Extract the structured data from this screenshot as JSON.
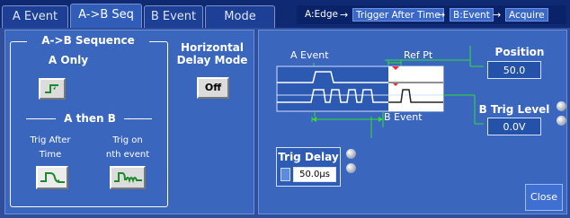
{
  "tabs": [
    {
      "label": "A Event",
      "active": false
    },
    {
      "label": "A->B Seq",
      "active": true
    },
    {
      "label": "B Event",
      "active": false
    },
    {
      "label": "Mode",
      "active": false
    }
  ],
  "breadcrumb": {
    "items": [
      "A:Edge",
      "Trigger After Time",
      "B:Event",
      "Acquire"
    ],
    "arrow": "→"
  },
  "sequence_group": {
    "title": "A->B Sequence",
    "a_only_label": "A Only",
    "a_then_b_label": "A then B",
    "trig_after_time_label_1": "Trig After",
    "trig_after_time_label_2": "Time",
    "trig_on_nth_label_1": "Trig on",
    "trig_on_nth_label_2": "nth event"
  },
  "horizontal_delay": {
    "title_line1": "Horizontal",
    "title_line2": "Delay Mode",
    "button_label": "Off"
  },
  "diagram": {
    "a_event_label": "A Event",
    "ref_pt_label": "Ref Pt",
    "b_event_label": "B Event"
  },
  "position": {
    "label": "Position",
    "value": "50.0"
  },
  "b_trig_level": {
    "label": "B Trig Level",
    "value": "0.0V"
  },
  "trig_delay": {
    "label": "Trig Delay",
    "value": "50.0µs"
  },
  "close_label": "Close",
  "colors": {
    "tabbar_bg": "#0f2a73",
    "panel_bg": "#3a66be",
    "waveform_bg": "#ffffff",
    "accent_green": "#33dd33",
    "trigger_red": "#ff2222"
  }
}
